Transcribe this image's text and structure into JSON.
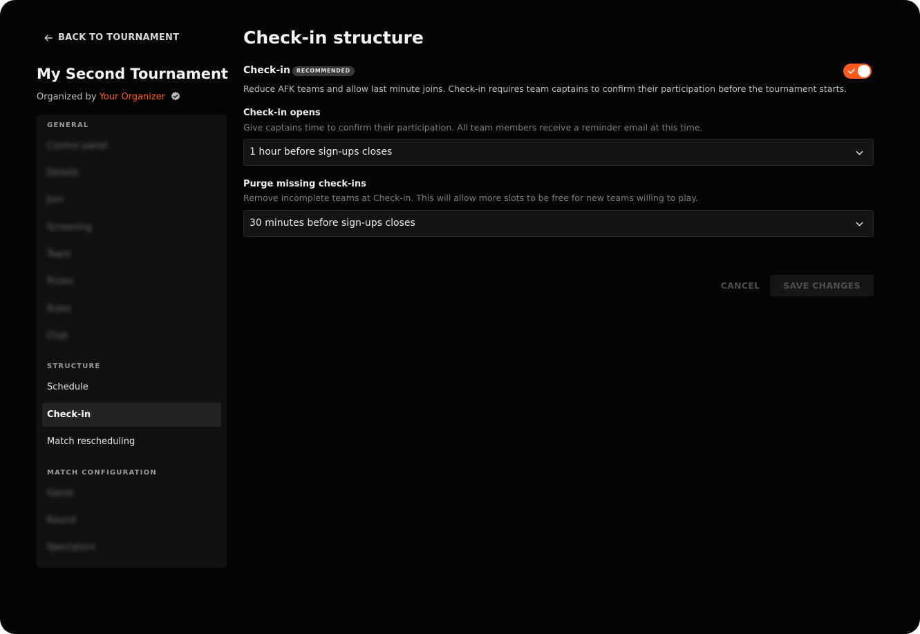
{
  "sidebar": {
    "back_label": "BACK TO TOURNAMENT",
    "tournament_name": "My Second Tournament",
    "organized_by_prefix": "Organized by",
    "organizer_name": "Your Organizer",
    "sections": {
      "general": {
        "label": "GENERAL",
        "items": [
          "Control panel",
          "Details",
          "Join",
          "Screening",
          "Team",
          "Prizes",
          "Rules",
          "Chat"
        ]
      },
      "structure": {
        "label": "STRUCTURE",
        "items": [
          "Schedule",
          "Check-in",
          "Match rescheduling"
        ],
        "active": "Check-in"
      },
      "match_configuration": {
        "label": "MATCH CONFIGURATION",
        "items": [
          "Game",
          "Round",
          "Spectators"
        ]
      }
    }
  },
  "main": {
    "title": "Check-in structure",
    "checkin": {
      "label": "Check-in",
      "badge": "RECOMMENDED",
      "enabled": true,
      "description": "Reduce AFK teams and allow last minute joins. Check-in requires team captains to confirm their participation before the tournament starts."
    },
    "checkin_opens": {
      "label": "Check-in opens",
      "description": "Give captains time to confirm their participation. All team members receive a reminder email at this time.",
      "value": "1 hour before sign-ups closes"
    },
    "purge_missing": {
      "label": "Purge missing check-ins",
      "description": "Remove incomplete teams at Check-in. This will allow more slots to be free for new teams willing to play.",
      "value": "30 minutes before sign-ups closes"
    },
    "actions": {
      "cancel": "CANCEL",
      "save": "SAVE CHANGES"
    }
  },
  "colors": {
    "accent": "#ff5a1f",
    "background": "#050505",
    "panel": "#111111"
  }
}
